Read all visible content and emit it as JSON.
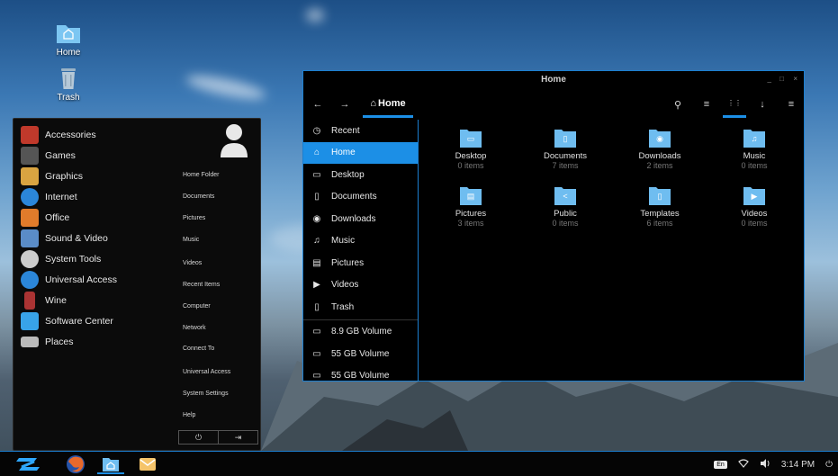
{
  "desktop": {
    "icons": [
      {
        "label": "Home",
        "icon": "home-folder-icon"
      },
      {
        "label": "Trash",
        "icon": "trash-icon"
      }
    ]
  },
  "startmenu": {
    "categories": [
      {
        "label": "Accessories",
        "icon": "accessories-icon",
        "color": "#c0392b"
      },
      {
        "label": "Games",
        "icon": "games-icon",
        "color": "#555555"
      },
      {
        "label": "Graphics",
        "icon": "graphics-icon",
        "color": "#d9a441"
      },
      {
        "label": "Internet",
        "icon": "internet-icon",
        "color": "#2b86d9"
      },
      {
        "label": "Office",
        "icon": "office-icon",
        "color": "#e07b2b"
      },
      {
        "label": "Sound & Video",
        "icon": "sound-video-icon",
        "color": "#5a8cc7"
      },
      {
        "label": "System Tools",
        "icon": "system-tools-icon",
        "color": "#cccccc"
      },
      {
        "label": "Universal Access",
        "icon": "universal-access-icon",
        "color": "#2b86d9"
      },
      {
        "label": "Wine",
        "icon": "wine-icon",
        "color": "#a33"
      },
      {
        "label": "Software Center",
        "icon": "software-center-icon",
        "color": "#38a3e8"
      },
      {
        "label": "Places",
        "icon": "places-icon",
        "color": "#bbbbbb"
      }
    ],
    "places": [
      "Home Folder",
      "Documents",
      "Pictures",
      "Music",
      "Videos",
      "Recent Items",
      "Computer",
      "Network",
      "Connect To",
      "Universal Access",
      "System Settings",
      "Help"
    ],
    "power_icon": "⏻",
    "logout_icon": "⇥"
  },
  "filemanager": {
    "title": "Home",
    "toolbar": {
      "back": "←",
      "forward": "→",
      "home_label": "Home",
      "home_glyph": "⌂",
      "search": "⚲",
      "list_view": "≡",
      "grid_view": "⋮⋮",
      "download": "↓",
      "menu": "≡"
    },
    "window_controls": {
      "minimize": "_",
      "maximize": "□",
      "close": "×"
    },
    "sidebar": [
      {
        "label": "Recent",
        "glyph": "◷"
      },
      {
        "label": "Home",
        "glyph": "⌂",
        "active": true
      },
      {
        "label": "Desktop",
        "glyph": "▭"
      },
      {
        "label": "Documents",
        "glyph": "▯"
      },
      {
        "label": "Downloads",
        "glyph": "◉"
      },
      {
        "label": "Music",
        "glyph": "♫"
      },
      {
        "label": "Pictures",
        "glyph": "▤"
      },
      {
        "label": "Videos",
        "glyph": "▶"
      },
      {
        "label": "Trash",
        "glyph": "▯"
      }
    ],
    "volumes": [
      {
        "label": "8.9 GB Volume",
        "glyph": "▭"
      },
      {
        "label": "55 GB Volume",
        "glyph": "▭"
      },
      {
        "label": "55 GB Volume",
        "glyph": "▭"
      }
    ],
    "folders": [
      {
        "name": "Desktop",
        "count": "0 items",
        "emblem": "▭"
      },
      {
        "name": "Documents",
        "count": "7 items",
        "emblem": "▯"
      },
      {
        "name": "Downloads",
        "count": "2 items",
        "emblem": "◉"
      },
      {
        "name": "Music",
        "count": "0 items",
        "emblem": "♫"
      },
      {
        "name": "Pictures",
        "count": "3 items",
        "emblem": "▤"
      },
      {
        "name": "Public",
        "count": "0 items",
        "emblem": "<"
      },
      {
        "name": "Templates",
        "count": "6 items",
        "emblem": "▯"
      },
      {
        "name": "Videos",
        "count": "0 items",
        "emblem": "▶"
      }
    ],
    "folder_color": "#6fbdf0"
  },
  "taskbar": {
    "keyboard_layout": "En",
    "time": "3:14 PM",
    "apps": [
      "zorin-menu-icon",
      "firefox-icon",
      "files-icon",
      "mail-icon"
    ]
  }
}
